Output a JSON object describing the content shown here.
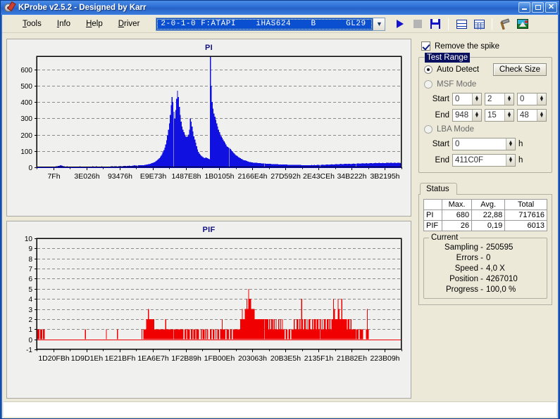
{
  "window": {
    "title": "KProbe v2.5.2 - Designed by Karr",
    "icon": "kprobe-disc-icon",
    "minimize_label": "_",
    "maximize_label": "□",
    "close_label": "✕"
  },
  "menu": {
    "items": [
      {
        "label": "Tools",
        "mnemonic": "T"
      },
      {
        "label": "Info",
        "mnemonic": "I"
      },
      {
        "label": "Help",
        "mnemonic": "H"
      },
      {
        "label": "Driver",
        "mnemonic": "D"
      }
    ]
  },
  "drive": {
    "selected": "2-0-1-0 F:ATAPI    iHAS624    B      GL29",
    "arrow": "⌄"
  },
  "toolbar": {
    "buttons": [
      {
        "name": "start-button",
        "icon": "play-icon"
      },
      {
        "name": "stop-button",
        "icon": "stop-icon"
      },
      {
        "name": "save-button",
        "icon": "floppy-save-icon"
      },
      {
        "name": "tile-windows-button",
        "icon": "tile-windows-icon"
      },
      {
        "name": "grid-view-button",
        "icon": "grid-icon"
      },
      {
        "name": "tools-button",
        "icon": "hammer-icon"
      },
      {
        "name": "image-button",
        "icon": "picture-icon"
      }
    ]
  },
  "options": {
    "remove_spike_label": "Remove the spike",
    "remove_spike_checked": true
  },
  "test_range": {
    "title": "Test Range",
    "auto_detect_label": "Auto Detect",
    "auto_detect_selected": true,
    "check_size_label": "Check Size",
    "msf_mode_label": "MSF Mode",
    "msf_mode_selected": false,
    "msf_start_label": "Start",
    "msf_start": [
      "0",
      "2",
      "0"
    ],
    "msf_end_label": "End",
    "msf_end": [
      "948",
      "15",
      "48"
    ],
    "lba_mode_label": "LBA Mode",
    "lba_mode_selected": false,
    "lba_start_label": "Start",
    "lba_start": "0",
    "lba_end_label": "End",
    "lba_end": "411C0F",
    "hex_unit": "h"
  },
  "status": {
    "tab_label": "Status",
    "table": {
      "headers": [
        "",
        "Max.",
        "Avg.",
        "Total"
      ],
      "rows": [
        {
          "label": "PI",
          "max": "680",
          "avg": "22,88",
          "total": "717616"
        },
        {
          "label": "PIF",
          "max": "26",
          "avg": "0,19",
          "total": "6013"
        }
      ]
    },
    "current": {
      "title": "Current",
      "rows": [
        {
          "key": "Sampling -",
          "value": "250595"
        },
        {
          "key": "Errors -",
          "value": "0"
        },
        {
          "key": "Speed -",
          "value": "4,0  X"
        },
        {
          "key": "Position -",
          "value": "4267010"
        },
        {
          "key": "Progress -",
          "value": "100,0 %"
        }
      ]
    }
  },
  "chart_data": [
    {
      "type": "area",
      "name": "pi-chart",
      "title": "PI",
      "color": "#1010E0",
      "xlabel": "",
      "ylabel": "",
      "ylim": [
        0,
        680
      ],
      "yticks": [
        0,
        100,
        200,
        300,
        400,
        500,
        600
      ],
      "grid": true,
      "legend": "none",
      "xticklabels": [
        "7Fh",
        "3E026h",
        "93476h",
        "E9E73h",
        "1487E8h",
        "1B0105h",
        "2166E4h",
        "27D592h",
        "2E43CEh",
        "34B222h",
        "3B2195h"
      ],
      "max_value": 680,
      "avg_value": 22.88,
      "total": 717616,
      "values": [
        3,
        4,
        5,
        4,
        3,
        4,
        5,
        4,
        3,
        4,
        5,
        4,
        3,
        4,
        3,
        4,
        5,
        4,
        3,
        4,
        5,
        6,
        7,
        8,
        9,
        10,
        12,
        10,
        8,
        7,
        6,
        5,
        5,
        6,
        5,
        4,
        5,
        4,
        5,
        4,
        5,
        4,
        5,
        4,
        5,
        4,
        5,
        6,
        5,
        4,
        5,
        4,
        5,
        4,
        5,
        4,
        5,
        4,
        5,
        4,
        5,
        6,
        5,
        4,
        5,
        6,
        5,
        4,
        5,
        4,
        5,
        6,
        5,
        4,
        5,
        4,
        5,
        4,
        5,
        4,
        5,
        6,
        7,
        6,
        5,
        6,
        7,
        6,
        5,
        6,
        7,
        8,
        7,
        6,
        7,
        8,
        9,
        8,
        7,
        8,
        9,
        10,
        9,
        8,
        9,
        10,
        11,
        12,
        11,
        10,
        11,
        12,
        13,
        14,
        13,
        12,
        13,
        14,
        15,
        16,
        17,
        18,
        19,
        20,
        22,
        24,
        26,
        28,
        30,
        33,
        36,
        40,
        45,
        50,
        56,
        63,
        70,
        80,
        92,
        105,
        120,
        140,
        165,
        195,
        230,
        270,
        320,
        380,
        430,
        400,
        340,
        300,
        350,
        420,
        470,
        430,
        370,
        320,
        280,
        250,
        230,
        215,
        200,
        190,
        185,
        190,
        200,
        230,
        300,
        280,
        250,
        220,
        190,
        170,
        150,
        130,
        110,
        95,
        85,
        78,
        72,
        66,
        62,
        58,
        55,
        60,
        58,
        55,
        52,
        50,
        680,
        500,
        400,
        360,
        330,
        310,
        290,
        270,
        250,
        230,
        215,
        200,
        190,
        180,
        170,
        160,
        150,
        140,
        130,
        125,
        120,
        118,
        112,
        105,
        98,
        92,
        86,
        80,
        74,
        70,
        66,
        62,
        58,
        55,
        52,
        49,
        46,
        44,
        42,
        40,
        38,
        36,
        34,
        33,
        32,
        31,
        30,
        29,
        28,
        28,
        27,
        27,
        26,
        26,
        25,
        25,
        24,
        24,
        23,
        23,
        23,
        22,
        22,
        22,
        21,
        21,
        21,
        20,
        20,
        20,
        20,
        19,
        19,
        19,
        19,
        18,
        18,
        18,
        18,
        18,
        17,
        17,
        17,
        17,
        17,
        16,
        16,
        16,
        16,
        16,
        16,
        16,
        15,
        15,
        15,
        15,
        15,
        15,
        15,
        15,
        14,
        14,
        14,
        14,
        14,
        14,
        14,
        14,
        14,
        14,
        14,
        15,
        14,
        14,
        15,
        14,
        14,
        15,
        16,
        15,
        14,
        15,
        16,
        17,
        16,
        15,
        16,
        17,
        18,
        17,
        16,
        17,
        18,
        19,
        18,
        17,
        18,
        19,
        20,
        19,
        18,
        19,
        20,
        21,
        20,
        19,
        20,
        21,
        22,
        21,
        20,
        21,
        22,
        21,
        20,
        21,
        22,
        23,
        22,
        21,
        22,
        23,
        24,
        23,
        22,
        23,
        24,
        25,
        24,
        23,
        24,
        25,
        24,
        23,
        24,
        25,
        26,
        25,
        24,
        25,
        26,
        27,
        26,
        25,
        26,
        27,
        26,
        25,
        26,
        27,
        26,
        25,
        26,
        27,
        28,
        27,
        26,
        27,
        28,
        27,
        26,
        27,
        28,
        27,
        26,
        27,
        28,
        27,
        26,
        27
      ]
    },
    {
      "type": "bar",
      "name": "pif-chart",
      "title": "PIF",
      "color": "#F00000",
      "xlabel": "",
      "ylabel": "",
      "ylim": [
        -1,
        10
      ],
      "yticks": [
        -1,
        0,
        1,
        2,
        3,
        4,
        5,
        6,
        7,
        8,
        9,
        10
      ],
      "grid": true,
      "legend": "none",
      "xticklabels": [
        "1D20FBh",
        "1D9D1Eh",
        "1E21BFh",
        "1EA6E7h",
        "1F2B89h",
        "1FB00Eh",
        "203063h",
        "20B3E5h",
        "2135F1h",
        "21B82Eh",
        "223B09h"
      ],
      "max_value": 26,
      "avg_value": 0.19,
      "total": 6013,
      "values": [
        1,
        1,
        1,
        0,
        1,
        1,
        0,
        1,
        1,
        0,
        0,
        0,
        0,
        0,
        0,
        0,
        0,
        0,
        0,
        0,
        0,
        0,
        0,
        0,
        0,
        0,
        0,
        0,
        0,
        0,
        0,
        0,
        0,
        0,
        0,
        0,
        0,
        0,
        0,
        0,
        0,
        0,
        0,
        0,
        0,
        0,
        0,
        0,
        0,
        0,
        0,
        0,
        0,
        1,
        0,
        0,
        0,
        0,
        0,
        0,
        0,
        0,
        0,
        0,
        0,
        0,
        0,
        0,
        0,
        0,
        0,
        0,
        0,
        0,
        0,
        0,
        1,
        0,
        0,
        0,
        0,
        0,
        0,
        0,
        0,
        0,
        0,
        0,
        1,
        0,
        0,
        0,
        0,
        0,
        0,
        0,
        0,
        0,
        0,
        0,
        0,
        0,
        0,
        0,
        0,
        0,
        0,
        0,
        0,
        0,
        0,
        0,
        0,
        0,
        0,
        1,
        0,
        1,
        1,
        1,
        2,
        2,
        3,
        2,
        2,
        2,
        2,
        2,
        2,
        1,
        1,
        1,
        1,
        1,
        1,
        1,
        1,
        1,
        1,
        1,
        1,
        2,
        1,
        1,
        1,
        1,
        1,
        1,
        1,
        1,
        1,
        1,
        1,
        1,
        1,
        1,
        1,
        1,
        1,
        1,
        1,
        0,
        1,
        1,
        0,
        1,
        1,
        1,
        0,
        1,
        1,
        0,
        1,
        1,
        0,
        1,
        1,
        1,
        0,
        0,
        1,
        0,
        1,
        1,
        0,
        1,
        0,
        1,
        0,
        0,
        1,
        1,
        0,
        1,
        1,
        0,
        1,
        0,
        1,
        1,
        0,
        1,
        1,
        2,
        1,
        1,
        1,
        0,
        1,
        1,
        1,
        0,
        1,
        1,
        0,
        1,
        1,
        1,
        1,
        1,
        1,
        1,
        1,
        2,
        2,
        3,
        2,
        2,
        3,
        3,
        4,
        3,
        5,
        4,
        4,
        3,
        3,
        3,
        3,
        2,
        2,
        2,
        2,
        2,
        2,
        2,
        2,
        2,
        2,
        2,
        2,
        2,
        2,
        2,
        1,
        2,
        1,
        2,
        2,
        1,
        2,
        1,
        2,
        1,
        1,
        2,
        1,
        2,
        1,
        2,
        1,
        1,
        0,
        1,
        1,
        0,
        1,
        1,
        0,
        1,
        1,
        1,
        2,
        1,
        1,
        2,
        2,
        1,
        2,
        1,
        4,
        2,
        1,
        2,
        2,
        1,
        2,
        1,
        2,
        2,
        1,
        1,
        2,
        1,
        2,
        2,
        1,
        2,
        2,
        1,
        2,
        2,
        1,
        2,
        1,
        2,
        2,
        1,
        2,
        2,
        1,
        2,
        1,
        2,
        2,
        4,
        3,
        2,
        2,
        2,
        4,
        3,
        2,
        2,
        4,
        2,
        2,
        2,
        2,
        2,
        1,
        2,
        2,
        1,
        2,
        1,
        1,
        1,
        1,
        1,
        1,
        1,
        1,
        0,
        1,
        1,
        1,
        1,
        0,
        0,
        0,
        1,
        3,
        1,
        0,
        0,
        0,
        0,
        0,
        0,
        0,
        0,
        0,
        0,
        0,
        0,
        0,
        0,
        0,
        0,
        0,
        0,
        0,
        0,
        0,
        0,
        0,
        0,
        0,
        0,
        0,
        0,
        0,
        0,
        0,
        0,
        0,
        0,
        0,
        0
      ]
    }
  ]
}
